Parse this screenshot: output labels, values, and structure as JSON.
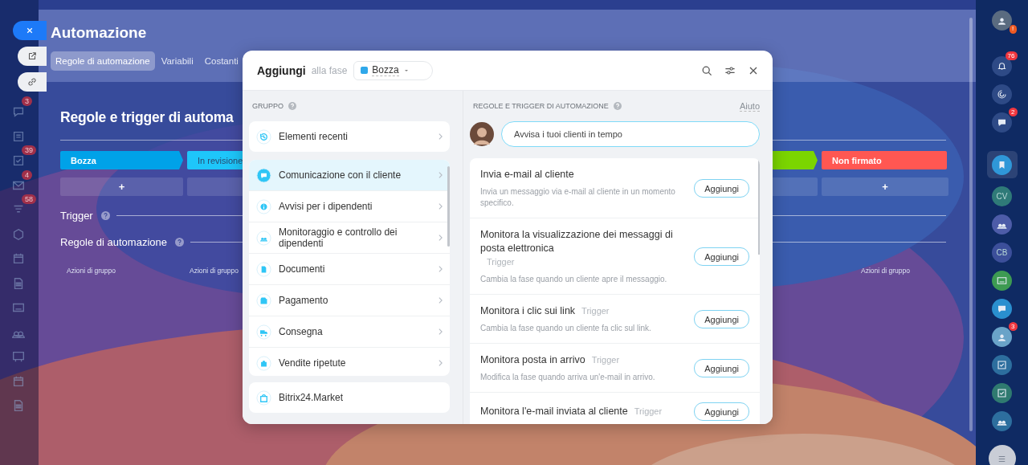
{
  "left_bar": [
    {
      "kind": "chat",
      "badge": "3"
    },
    {
      "kind": "list"
    },
    {
      "kind": "task",
      "badge": "39"
    },
    {
      "kind": "mail",
      "badge": "4"
    },
    {
      "kind": "filter",
      "badge": "58"
    },
    {
      "kind": "hex"
    },
    {
      "kind": "calendar"
    },
    {
      "kind": "doc"
    },
    {
      "kind": "card"
    },
    {
      "kind": "people"
    },
    {
      "kind": "board"
    },
    {
      "kind": "calendar"
    },
    {
      "kind": "doc"
    }
  ],
  "panel_actions": [
    {
      "kind": "close"
    },
    {
      "kind": "open"
    },
    {
      "kind": "link"
    }
  ],
  "panel": {
    "title": "Automazione",
    "tabs": [
      {
        "label": "Regole di automazione",
        "selected": true
      },
      {
        "label": "Variabili",
        "selected": false
      },
      {
        "label": "Costanti",
        "selected": false
      }
    ]
  },
  "board": {
    "heading": "Regole e trigger di automa",
    "stages": [
      {
        "label": "Bozza",
        "color": "#00a2e8",
        "add": "+",
        "group_action": "Azioni di gruppo"
      },
      {
        "label": "In revisione",
        "color": "#1ec6fa",
        "group_action": "Azioni di gruppo"
      },
      {
        "color": "#7bd500"
      },
      {
        "label": "Non firmato",
        "color": "#ff5752",
        "add": "+",
        "group_action": "Azioni di gruppo"
      }
    ],
    "sections": [
      {
        "label": "Trigger"
      },
      {
        "label": "Regole di automazione"
      }
    ]
  },
  "right_bar": [
    {
      "kind": "user",
      "badge": "!",
      "color": "#5a6b80",
      "selected": false
    },
    {
      "kind": "bell",
      "badge": "76",
      "color": "#2e4a86",
      "selected": false
    },
    {
      "kind": "spiral",
      "color": "#2e4a86",
      "selected": false
    },
    {
      "kind": "chat",
      "badge": "2",
      "color": "#2e4a86",
      "selected": false
    },
    {
      "kind": "bookmark",
      "color": "#2f97d8",
      "selected": true
    },
    {
      "kind": "initials",
      "text": "CV",
      "color": "#2f7a78",
      "selected": false
    },
    {
      "kind": "group",
      "color": "#4d5ca8",
      "selected": false
    },
    {
      "kind": "initials",
      "text": "CB",
      "color": "#3c4f9a",
      "selected": false
    },
    {
      "kind": "card",
      "color": "#3d9a52",
      "selected": false
    },
    {
      "kind": "chat",
      "color": "#2a8fcf",
      "selected": false
    },
    {
      "kind": "user",
      "badge": "3",
      "color": "#6aa3c8",
      "selected": false
    },
    {
      "kind": "task",
      "color": "#2d6e9e",
      "selected": false
    },
    {
      "kind": "task",
      "color": "#2f7a70",
      "selected": false
    },
    {
      "kind": "group",
      "color": "#2d6e9e",
      "selected": false
    },
    {
      "kind": "menu",
      "color": "#c9cdd6",
      "selected": false
    }
  ],
  "dialog": {
    "title": "Aggiungi",
    "subtitle": "alla fase",
    "stage": {
      "label": "Bozza",
      "color": "#2fa8ea"
    },
    "group_heading": "GRUPPO",
    "recent": "Elementi recenti",
    "groups": [
      {
        "label": "Comunicazione con il cliente",
        "kind": "chat",
        "selected": true
      },
      {
        "label": "Avvisi per i dipendenti",
        "kind": "info",
        "selected": false
      },
      {
        "label": "Monitoraggio e controllo dei dipendenti",
        "kind": "people",
        "selected": false
      },
      {
        "label": "Documenti",
        "kind": "doc",
        "selected": false
      },
      {
        "label": "Pagamento",
        "kind": "wallet",
        "selected": false
      },
      {
        "label": "Consegna",
        "kind": "truck",
        "selected": false
      },
      {
        "label": "Vendite ripetute",
        "kind": "bag",
        "selected": false
      }
    ],
    "market": "Bitrix24.Market",
    "rules_heading": "REGOLE E TRIGGER DI AUTOMAZIONE",
    "help": "Aiuto",
    "tip": "Avvisa i tuoi clienti in tempo",
    "rules": [
      {
        "title": "Invia e-mail al cliente",
        "description": "Invia un messaggio via e-mail al cliente in un momento specifico.",
        "button": "Aggiungi"
      },
      {
        "title": "Monitora la visualizzazione dei messaggi di posta elettronica",
        "tag": "Trigger",
        "description": "Cambia la fase quando un cliente apre il messaggio.",
        "button": "Aggiungi"
      },
      {
        "title": "Monitora i clic sui link",
        "tag": "Trigger",
        "description": "Cambia la fase quando un cliente fa clic sul link.",
        "button": "Aggiungi"
      },
      {
        "title": "Monitora posta in arrivo",
        "tag": "Trigger",
        "description": "Modifica la fase quando arriva un'e-mail in arrivo.",
        "button": "Aggiungi"
      },
      {
        "title": "Monitora l'e-mail inviata al cliente",
        "tag": "Trigger",
        "button": "Aggiungi"
      }
    ]
  }
}
